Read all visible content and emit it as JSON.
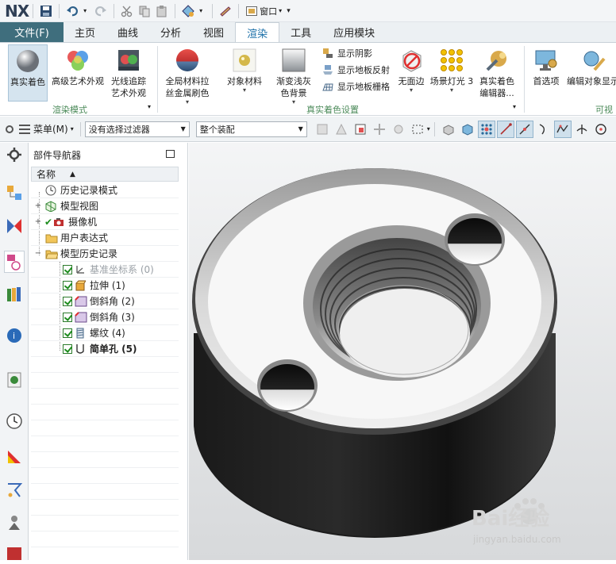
{
  "app": {
    "logo": "NX",
    "window_menu_label": "窗口"
  },
  "tabs": [
    {
      "label": "文件(F)"
    },
    {
      "label": "主页"
    },
    {
      "label": "曲线"
    },
    {
      "label": "分析"
    },
    {
      "label": "视图"
    },
    {
      "label": "渲染"
    },
    {
      "label": "工具"
    },
    {
      "label": "应用模块"
    }
  ],
  "ribbon": {
    "realistic_shading": "真实着色",
    "advanced_art": "高级艺术外观",
    "raytrace_line1": "光线追踪",
    "raytrace_line2": "艺术外观",
    "global_material_line1": "全局材料拉",
    "global_material_line2": "丝金属刷色",
    "object_material": "对象材料",
    "gradient_bg_line1": "渐变浅灰",
    "gradient_bg_line2": "色背景",
    "show_shadow": "显示阴影",
    "show_floor_reflect": "显示地板反射",
    "show_floor_grid": "显示地板栅格",
    "no_face_edge": "无面边",
    "scene_light": "场景灯光 3",
    "rs_editor_line1": "真实着色",
    "rs_editor_line2": "编辑器...",
    "preferences": "首选项",
    "edit_object_display": "编辑对象显示",
    "group_render_mode": "渲染模式",
    "group_rs_settings": "真实着色设置",
    "group_visual_partial": "可视化"
  },
  "selbar": {
    "menu_label": "菜单(M)",
    "filter_value": "没有选择过滤器",
    "assembly_value": "整个装配"
  },
  "navigator": {
    "title": "部件导航器",
    "column_name": "名称",
    "items": [
      {
        "label": "历史记录模式"
      },
      {
        "label": "模型视图"
      },
      {
        "label": "摄像机"
      },
      {
        "label": "用户表达式"
      },
      {
        "label": "模型历史记录"
      },
      {
        "label": "基准坐标系 (0)"
      },
      {
        "label": "拉伸 (1)"
      },
      {
        "label": "倒斜角 (2)"
      },
      {
        "label": "倒斜角 (3)"
      },
      {
        "label": "螺纹 (4)"
      },
      {
        "label": "简单孔 (5)"
      }
    ]
  },
  "watermark": {
    "brand_text": "Bai经验",
    "url": "jingyan.baidu.com"
  },
  "colors": {
    "file_tab": "#3f6e7d",
    "active_tab_text": "#1b6fa8",
    "group_label": "#4b8a59",
    "checkbox": "#1d8c1d"
  }
}
